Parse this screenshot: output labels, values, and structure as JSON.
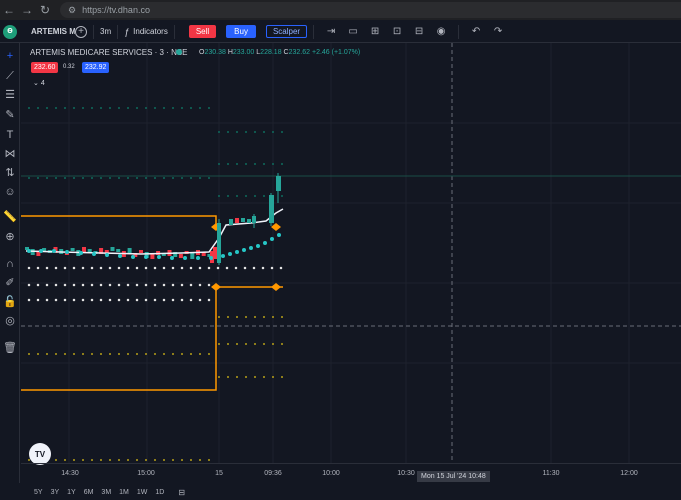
{
  "browser": {
    "url": "https://tv.dhan.co"
  },
  "toolbar": {
    "symbol": "ARTEMIS ME",
    "interval": "3m",
    "indicators_label": "Indicators",
    "sell_label": "Sell",
    "buy_label": "Buy",
    "scalper_label": "Scalper"
  },
  "legend": {
    "title": "ARTEMIS MEDICARE SERVICES · 3 · NSE",
    "o_label": "O",
    "o": "230.38",
    "h_label": "H",
    "h": "233.00",
    "l_label": "L",
    "l": "228.18",
    "c_label": "C",
    "c": "232.62",
    "change": "+2.46 (+1.07%)",
    "sell_price": "232.60",
    "spread": "0.32",
    "buy_price": "232.92",
    "indicator_count": "4"
  },
  "time_axis": {
    "ticks": [
      "14:30",
      "15:00",
      "15",
      "09:36",
      "10:00",
      "10:30",
      "11:30",
      "12:00"
    ],
    "crosshair_label": "Mon 15 Jul '24   10:48"
  },
  "bottom_bar": {
    "ranges": [
      "5Y",
      "3Y",
      "1Y",
      "6M",
      "3M",
      "1M",
      "1W",
      "1D"
    ]
  },
  "colors": {
    "up": "#26a69a",
    "down": "#f23645",
    "orange": "#ff9800",
    "background": "#131722"
  },
  "chart_data": {
    "type": "candlestick",
    "title": "",
    "symbol": "ARTEMIS MEDICARE SERVICES",
    "interval": "3",
    "exchange": "NSE",
    "last": {
      "open": 230.38,
      "high": 233.0,
      "low": 228.18,
      "close": 232.62
    },
    "x_ticks": [
      "14:30",
      "15:00",
      "15",
      "09:36",
      "10:00",
      "10:30",
      "11:30",
      "12:00"
    ]
  }
}
